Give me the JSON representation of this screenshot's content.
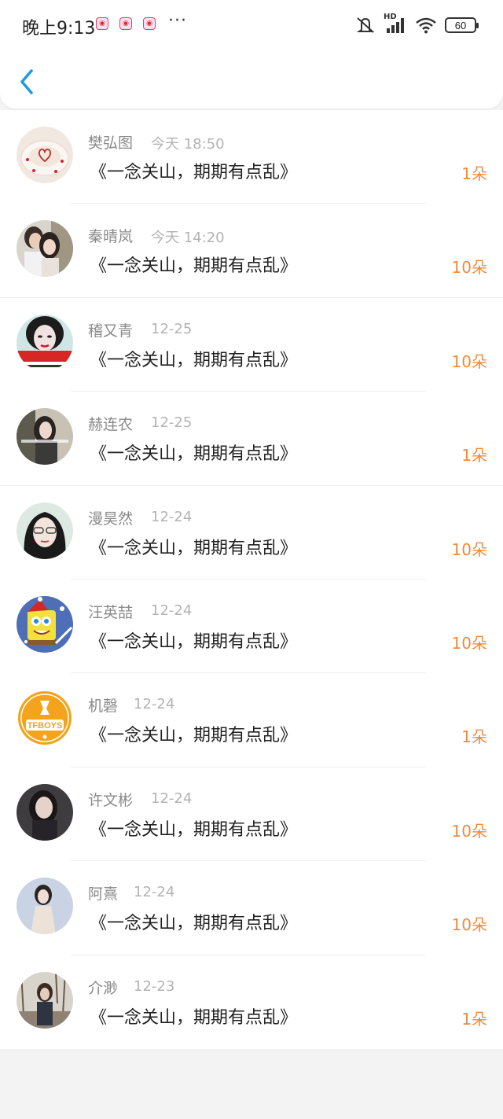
{
  "status": {
    "time": "晚上9:13",
    "more": "···",
    "hd": "HD",
    "battery": "60"
  },
  "header": {
    "back_icon": "chevron-left-icon",
    "accent_color": "#1f9bdc"
  },
  "messages": [
    {
      "name": "樊弘图",
      "time": "今天 18:50",
      "title": "《一念关山，期期有点乱》",
      "count": "1朵"
    },
    {
      "name": "秦晴岚",
      "time": "今天 14:20",
      "title": "《一念关山，期期有点乱》",
      "count": "10朵"
    },
    {
      "name": "稽又青",
      "time": "12-25",
      "title": "《一念关山，期期有点乱》",
      "count": "10朵"
    },
    {
      "name": "赫连农",
      "time": "12-25",
      "title": "《一念关山，期期有点乱》",
      "count": "1朵"
    },
    {
      "name": "漫昊然",
      "time": "12-24",
      "title": "《一念关山，期期有点乱》",
      "count": "10朵"
    },
    {
      "name": "汪英喆",
      "time": "12-24",
      "title": "《一念关山，期期有点乱》",
      "count": "10朵"
    },
    {
      "name": "机磬",
      "time": "12-24",
      "title": "《一念关山，期期有点乱》",
      "count": "1朵"
    },
    {
      "name": "许文彬",
      "time": "12-24",
      "title": "《一念关山，期期有点乱》",
      "count": "10朵"
    },
    {
      "name": "阿熹",
      "time": "12-24",
      "title": "《一念关山，期期有点乱》",
      "count": "10朵"
    },
    {
      "name": "介渺",
      "time": "12-23",
      "title": "《一念关山，期期有点乱》",
      "count": "1朵"
    }
  ],
  "colors": {
    "count": "#f08a3c",
    "name": "#8a8a8a",
    "time": "#b3b3b3"
  },
  "avatar_text": {
    "badge": "TFBOYS"
  }
}
